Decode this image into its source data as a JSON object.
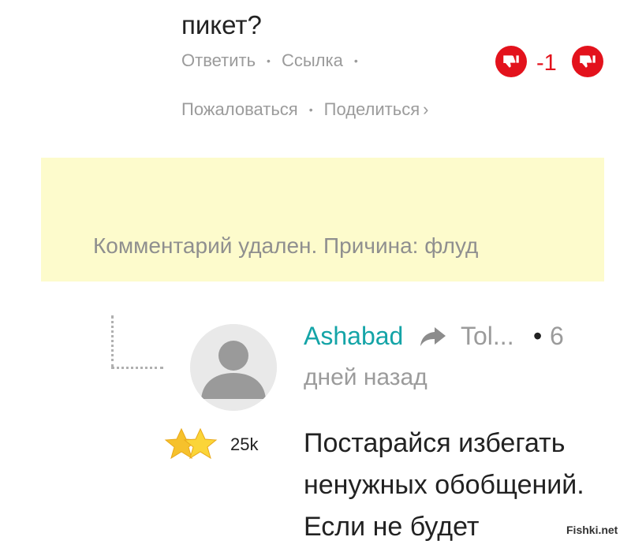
{
  "previous_comment": {
    "text_tail": "пикет?",
    "actions": {
      "reply": "Ответить",
      "link": "Ссылка",
      "report": "Пожаловаться",
      "share": "Поделиться",
      "share_caret": "›",
      "separator": "•"
    },
    "score": "-1"
  },
  "deleted_comment": {
    "message": "Комментарий удален. Причина: флуд",
    "background": "#fdfbcc"
  },
  "reply": {
    "author": "Ashabad",
    "reply_to": "Tol...",
    "bullet": "•",
    "time_number": "6",
    "time_rest": "дней назад",
    "rating": "25k",
    "body": "Постарайся избегать ненужных обобщений. Если не будет",
    "author_color": "#14a4a7"
  },
  "icons": {
    "vote_down": "thumbs-down-icon",
    "reply_arrow": "reply-arrow-icon",
    "avatar": "user-avatar-icon",
    "stars": "star-icon"
  },
  "colors": {
    "vote_red": "#e3121c",
    "muted": "#9b9b9b"
  },
  "watermark": "Fishki.net"
}
